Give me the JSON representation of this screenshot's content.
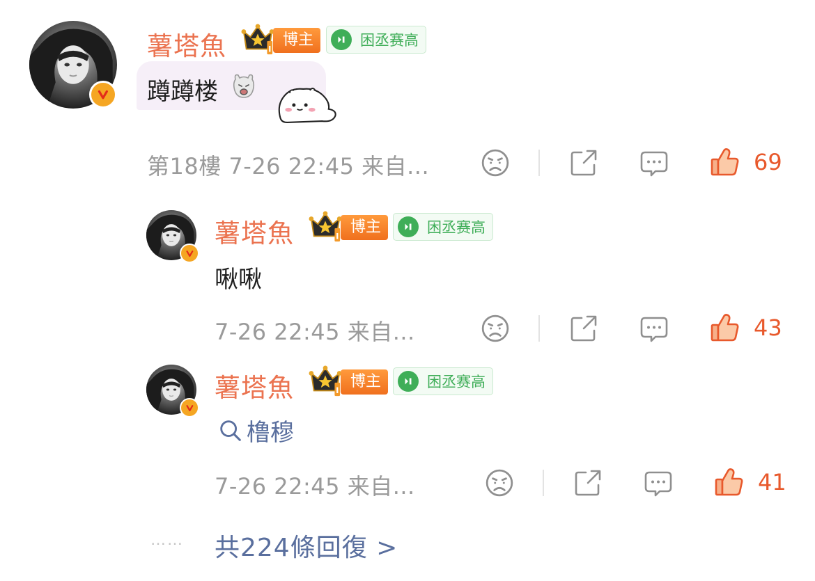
{
  "comments": [
    {
      "author": "薯塔魚",
      "role_badge": "博主",
      "fan_badge": "困丞赛高",
      "text": "蹲蹲楼",
      "floor": "第18樓",
      "time": "7-26 22:45",
      "source": "来自...",
      "likes": "69",
      "sticker_icon": "sheep-emoji-icon"
    },
    {
      "author": "薯塔魚",
      "role_badge": "博主",
      "fan_badge": "困丞赛高",
      "text": "啾啾",
      "time": "7-26 22:45",
      "source": "来自...",
      "likes": "43"
    },
    {
      "author": "薯塔魚",
      "role_badge": "博主",
      "fan_badge": "困丞赛高",
      "search_text": "橹穆",
      "time": "7-26 22:45",
      "source": "来自...",
      "likes": "41"
    }
  ],
  "more": {
    "dots": "……",
    "label": "共224條回復 >"
  },
  "colors": {
    "name": "#eb7350",
    "like": "#e8592c",
    "link": "#5a6f9e",
    "meta": "#9a9a9a",
    "fan_green": "#3fae58",
    "role_orange": "#f0701e"
  }
}
